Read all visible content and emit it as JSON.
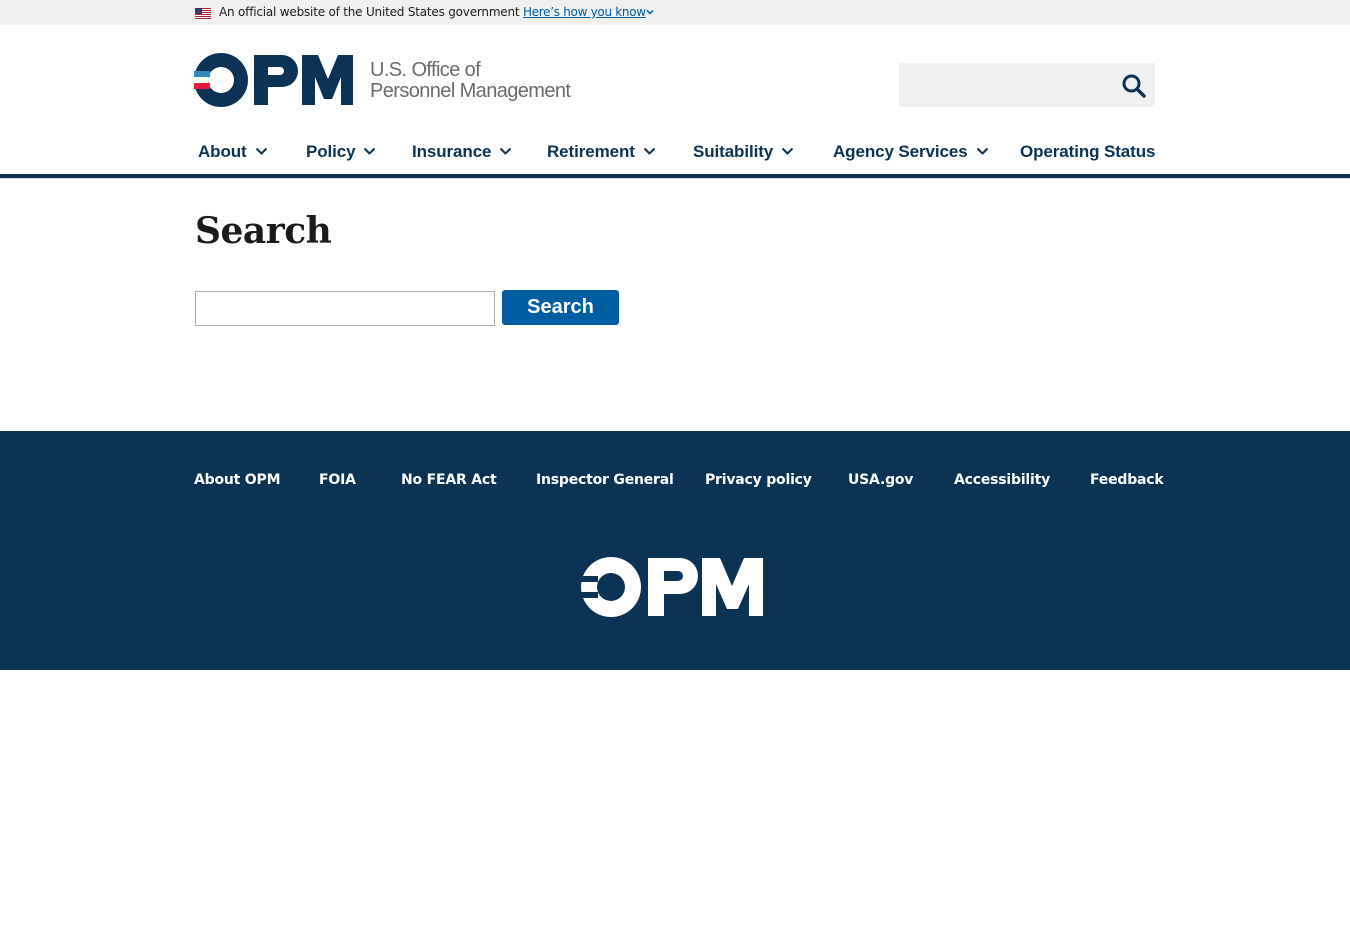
{
  "gov_banner": {
    "official_text": "An official website of the United States government",
    "how_you_know": "Here’s how you know"
  },
  "header": {
    "logo_text": "OPM",
    "agency_line1": "U.S. Office of",
    "agency_line2": "Personnel Management",
    "search_placeholder": "",
    "search_value": ""
  },
  "nav": {
    "items": [
      {
        "label": "About",
        "has_dropdown": true
      },
      {
        "label": "Policy",
        "has_dropdown": true
      },
      {
        "label": "Insurance",
        "has_dropdown": true
      },
      {
        "label": "Retirement",
        "has_dropdown": true
      },
      {
        "label": "Suitability",
        "has_dropdown": true
      },
      {
        "label": "Agency Services",
        "has_dropdown": true
      },
      {
        "label": "Operating Status",
        "has_dropdown": false
      }
    ]
  },
  "main": {
    "title": "Search",
    "search_value": "",
    "search_button": "Search"
  },
  "footer": {
    "links": [
      "About OPM",
      "FOIA",
      "No FEAR Act",
      "Inspector General",
      "Privacy policy",
      "USA.gov",
      "Accessibility",
      "Feedback"
    ],
    "logo_text": "OPM"
  },
  "colors": {
    "primary_navy": "#0c3354",
    "button_blue": "#005ea2",
    "logo_red": "#e31c3d",
    "logo_light_blue": "#2e8bc0",
    "banner_gray": "#f0f0f0"
  }
}
